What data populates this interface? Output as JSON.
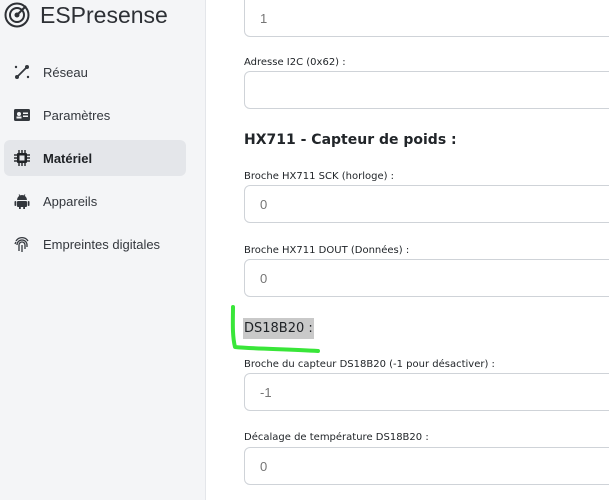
{
  "app": {
    "title": "ESPresense"
  },
  "sidebar": {
    "items": [
      {
        "label": "Réseau",
        "icon": "network-icon"
      },
      {
        "label": "Paramètres",
        "icon": "id-card-icon"
      },
      {
        "label": "Matériel",
        "icon": "chip-icon",
        "active": true
      },
      {
        "label": "Appareils",
        "icon": "android-icon"
      },
      {
        "label": "Empreintes digitales",
        "icon": "fingerprint-icon"
      }
    ]
  },
  "main": {
    "top_field": {
      "placeholder": "1"
    },
    "i2c": {
      "label": "Adresse I2C (0x62) :",
      "placeholder": ""
    },
    "hx711": {
      "title": "HX711 - Capteur de poids :",
      "sck": {
        "label": "Broche HX711 SCK (horloge) :",
        "placeholder": "0"
      },
      "dout": {
        "label": "Broche HX711 DOUT (Données) :",
        "placeholder": "0"
      }
    },
    "ds18b20": {
      "title": "DS18B20 :",
      "pin": {
        "label": "Broche du capteur DS18B20 (-1 pour désactiver) :",
        "placeholder": "-1"
      },
      "offset": {
        "label": "Décalage de température DS18B20 :",
        "placeholder": "0"
      }
    }
  },
  "colors": {
    "annotation": "#39e639",
    "highlight": "#c9c9c9",
    "sidebar_bg": "#f4f5f7",
    "active_item_bg": "#e4e6ea"
  }
}
